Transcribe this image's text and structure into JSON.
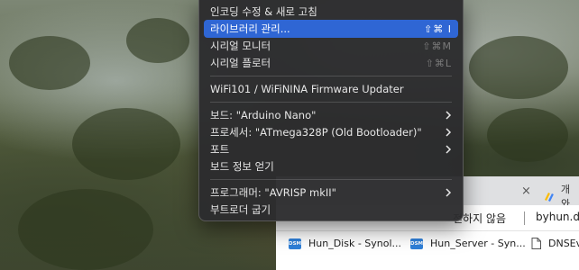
{
  "menu": {
    "items": [
      {
        "label": "인코딩 수정 & 새로 고침",
        "shortcut": ""
      },
      {
        "label": "라이브러리 관리...",
        "shortcut": "⇧⌘ I",
        "active": true
      },
      {
        "label": "시리얼 모니터",
        "shortcut": "⇧⌘M"
      },
      {
        "label": "시리얼 플로터",
        "shortcut": "⇧⌘L"
      },
      {
        "label": "WiFi101 / WiFiNINA Firmware Updater",
        "shortcut": ""
      },
      {
        "label": "보드: \"Arduino Nano\"",
        "submenu": true
      },
      {
        "label": "프로세서: \"ATmega328P (Old Bootloader)\"",
        "submenu": true
      },
      {
        "label": "포트",
        "submenu": true
      },
      {
        "label": "보드 정보 얻기"
      },
      {
        "label": "프로그래머: \"AVRISP mkII\"",
        "submenu": true
      },
      {
        "label": "부트로더 굽기"
      }
    ],
    "accent": "#2f66d4"
  },
  "browser": {
    "tab_close": "×",
    "tab2_label": "개와",
    "address": {
      "security_warning": "전하지 않음",
      "host": "byhun.d"
    },
    "bookmarks": [
      {
        "icon": "dsm-icon",
        "icon_text": "DSM",
        "label": "Hun_Disk - Synol..."
      },
      {
        "icon": "dsm-icon",
        "icon_text": "DSM",
        "label": "Hun_Server - Syn..."
      },
      {
        "icon": "document-icon",
        "label": "DNSEv"
      }
    ]
  }
}
